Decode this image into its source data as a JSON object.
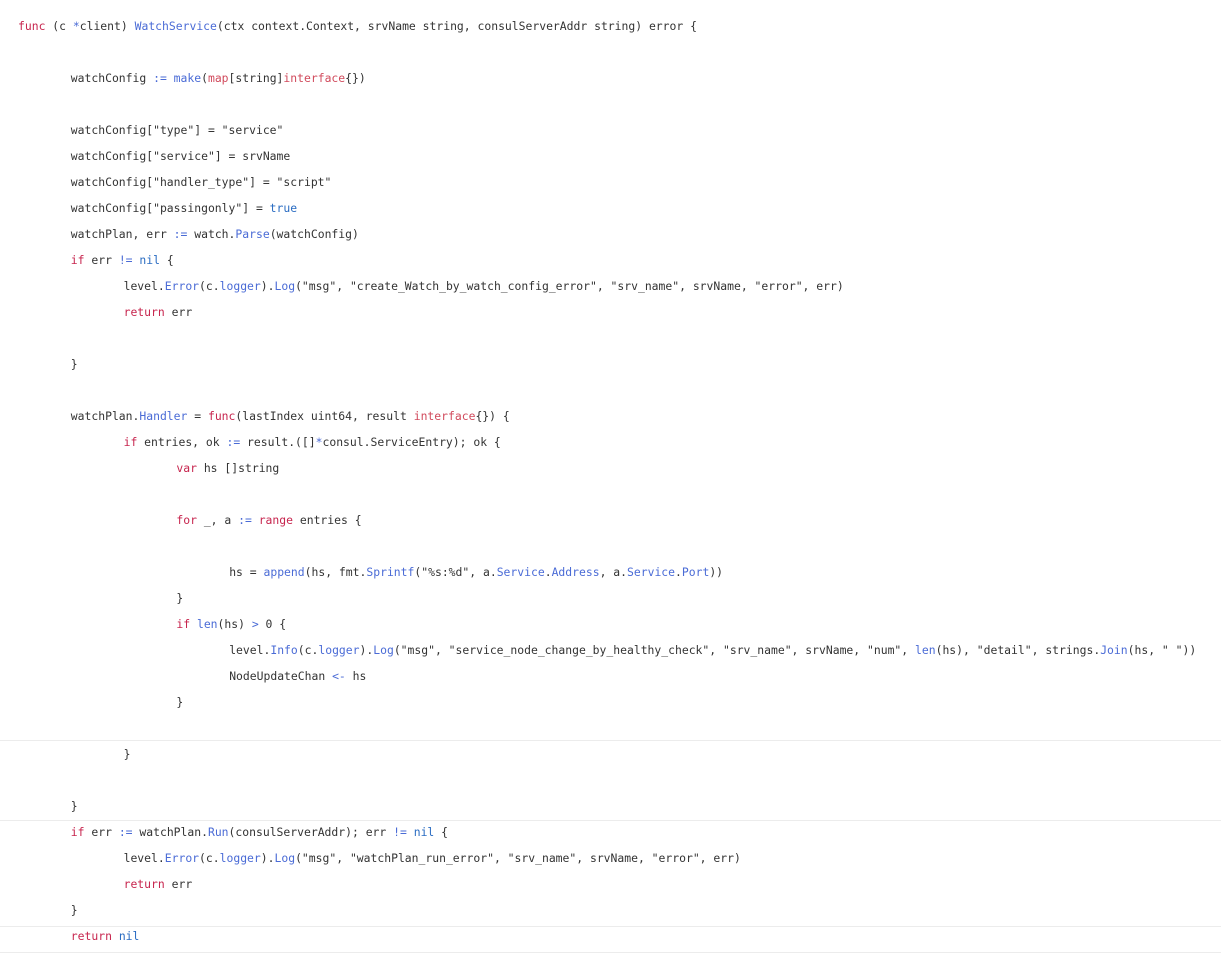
{
  "colors": {
    "background": "#ffffff",
    "plain": "#333333",
    "keyword": "#c7254e",
    "function": "#4a6bd6",
    "type": "#d14a5c",
    "literal": "#2a6cc2"
  },
  "code": {
    "language": "go",
    "lines": [
      {
        "indent": 0,
        "tokens": [
          [
            "k",
            "func"
          ],
          [
            "p",
            " (c "
          ],
          [
            "o",
            "*"
          ],
          [
            "p",
            "client) "
          ],
          [
            "f",
            "WatchService"
          ],
          [
            "p",
            "(ctx context.Context, srvName string, consulServerAddr string) error {"
          ]
        ]
      },
      {
        "indent": 0,
        "tokens": []
      },
      {
        "indent": 1,
        "tokens": [
          [
            "p",
            "watchConfig "
          ],
          [
            "o",
            ":="
          ],
          [
            "p",
            " "
          ],
          [
            "f",
            "make"
          ],
          [
            "p",
            "("
          ],
          [
            "t",
            "map"
          ],
          [
            "p",
            "[string]"
          ],
          [
            "t",
            "interface"
          ],
          [
            "p",
            "{})"
          ]
        ]
      },
      {
        "indent": 0,
        "tokens": []
      },
      {
        "indent": 1,
        "tokens": [
          [
            "p",
            "watchConfig[\"type\"] = \"service\""
          ]
        ]
      },
      {
        "indent": 1,
        "tokens": [
          [
            "p",
            "watchConfig[\"service\"] = srvName"
          ]
        ]
      },
      {
        "indent": 1,
        "tokens": [
          [
            "p",
            "watchConfig[\"handler_type\"] = \"script\""
          ]
        ]
      },
      {
        "indent": 1,
        "tokens": [
          [
            "p",
            "watchConfig[\"passingonly\"] = "
          ],
          [
            "l",
            "true"
          ]
        ]
      },
      {
        "indent": 1,
        "tokens": [
          [
            "p",
            "watchPlan, err "
          ],
          [
            "o",
            ":="
          ],
          [
            "p",
            " watch."
          ],
          [
            "f",
            "Parse"
          ],
          [
            "p",
            "(watchConfig)"
          ]
        ]
      },
      {
        "indent": 1,
        "tokens": [
          [
            "k",
            "if"
          ],
          [
            "p",
            " err "
          ],
          [
            "o",
            "!="
          ],
          [
            "p",
            " "
          ],
          [
            "l",
            "nil"
          ],
          [
            "p",
            " {"
          ]
        ]
      },
      {
        "indent": 2,
        "tokens": [
          [
            "p",
            "level."
          ],
          [
            "f",
            "Error"
          ],
          [
            "p",
            "(c."
          ],
          [
            "f",
            "logger"
          ],
          [
            "p",
            ")."
          ],
          [
            "f",
            "Log"
          ],
          [
            "p",
            "(\"msg\", \"create_Watch_by_watch_config_error\", \"srv_name\", srvName, \"error\", err)"
          ]
        ]
      },
      {
        "indent": 2,
        "tokens": [
          [
            "k",
            "return"
          ],
          [
            "p",
            " err"
          ]
        ]
      },
      {
        "indent": 0,
        "tokens": []
      },
      {
        "indent": 1,
        "tokens": [
          [
            "p",
            "}"
          ]
        ]
      },
      {
        "indent": 0,
        "tokens": []
      },
      {
        "indent": 1,
        "tokens": [
          [
            "p",
            "watchPlan."
          ],
          [
            "f",
            "Handler"
          ],
          [
            "p",
            " = "
          ],
          [
            "k",
            "func"
          ],
          [
            "p",
            "(lastIndex uint64, result "
          ],
          [
            "t",
            "interface"
          ],
          [
            "p",
            "{}) {"
          ]
        ]
      },
      {
        "indent": 2,
        "tokens": [
          [
            "k",
            "if"
          ],
          [
            "p",
            " entries, ok "
          ],
          [
            "o",
            ":="
          ],
          [
            "p",
            " result.([]"
          ],
          [
            "o",
            "*"
          ],
          [
            "p",
            "consul.ServiceEntry); ok {"
          ]
        ]
      },
      {
        "indent": 3,
        "tokens": [
          [
            "k",
            "var"
          ],
          [
            "p",
            " hs []string"
          ]
        ]
      },
      {
        "indent": 0,
        "tokens": []
      },
      {
        "indent": 3,
        "tokens": [
          [
            "k",
            "for"
          ],
          [
            "p",
            " _, a "
          ],
          [
            "o",
            ":="
          ],
          [
            "p",
            " "
          ],
          [
            "k",
            "range"
          ],
          [
            "p",
            " entries {"
          ]
        ]
      },
      {
        "indent": 0,
        "tokens": []
      },
      {
        "indent": 4,
        "tokens": [
          [
            "p",
            "hs = "
          ],
          [
            "f",
            "append"
          ],
          [
            "p",
            "(hs, fmt."
          ],
          [
            "f",
            "Sprintf"
          ],
          [
            "p",
            "(\"%s:%d\", a."
          ],
          [
            "f",
            "Service"
          ],
          [
            "p",
            "."
          ],
          [
            "f",
            "Address"
          ],
          [
            "p",
            ", a."
          ],
          [
            "f",
            "Service"
          ],
          [
            "p",
            "."
          ],
          [
            "f",
            "Port"
          ],
          [
            "p",
            "))"
          ]
        ]
      },
      {
        "indent": 3,
        "tokens": [
          [
            "p",
            "}"
          ]
        ]
      },
      {
        "indent": 3,
        "tokens": [
          [
            "k",
            "if"
          ],
          [
            "p",
            " "
          ],
          [
            "f",
            "len"
          ],
          [
            "p",
            "(hs) "
          ],
          [
            "o",
            ">"
          ],
          [
            "p",
            " 0 {"
          ]
        ]
      },
      {
        "indent": 4,
        "tokens": [
          [
            "p",
            "level."
          ],
          [
            "f",
            "Info"
          ],
          [
            "p",
            "(c."
          ],
          [
            "f",
            "logger"
          ],
          [
            "p",
            ")."
          ],
          [
            "f",
            "Log"
          ],
          [
            "p",
            "(\"msg\", \"service_node_change_by_healthy_check\", \"srv_name\", srvName, \"num\", "
          ],
          [
            "f",
            "len"
          ],
          [
            "p",
            "(hs), \"detail\", strings."
          ],
          [
            "f",
            "Join"
          ],
          [
            "p",
            "(hs, \" \"))"
          ]
        ]
      },
      {
        "indent": 4,
        "tokens": [
          [
            "p",
            "NodeUpdateChan "
          ],
          [
            "o",
            "<-"
          ],
          [
            "p",
            " hs"
          ]
        ]
      },
      {
        "indent": 3,
        "tokens": [
          [
            "p",
            "}"
          ]
        ]
      },
      {
        "indent": 0,
        "tokens": []
      },
      {
        "indent": 2,
        "tokens": [
          [
            "p",
            "}"
          ]
        ]
      },
      {
        "indent": 0,
        "tokens": []
      },
      {
        "indent": 1,
        "tokens": [
          [
            "p",
            "}"
          ]
        ]
      },
      {
        "indent": 1,
        "tokens": [
          [
            "k",
            "if"
          ],
          [
            "p",
            " err "
          ],
          [
            "o",
            ":="
          ],
          [
            "p",
            " watchPlan."
          ],
          [
            "f",
            "Run"
          ],
          [
            "p",
            "(consulServerAddr); err "
          ],
          [
            "o",
            "!="
          ],
          [
            "p",
            " "
          ],
          [
            "l",
            "nil"
          ],
          [
            "p",
            " {"
          ]
        ]
      },
      {
        "indent": 2,
        "tokens": [
          [
            "p",
            "level."
          ],
          [
            "f",
            "Error"
          ],
          [
            "p",
            "(c."
          ],
          [
            "f",
            "logger"
          ],
          [
            "p",
            ")."
          ],
          [
            "f",
            "Log"
          ],
          [
            "p",
            "(\"msg\", \"watchPlan_run_error\", \"srv_name\", srvName, \"error\", err)"
          ]
        ]
      },
      {
        "indent": 2,
        "tokens": [
          [
            "k",
            "return"
          ],
          [
            "p",
            " err"
          ]
        ]
      },
      {
        "indent": 1,
        "tokens": [
          [
            "p",
            "}"
          ]
        ]
      },
      {
        "indent": 1,
        "tokens": [
          [
            "k",
            "return"
          ],
          [
            "p",
            " "
          ],
          [
            "l",
            "nil"
          ]
        ]
      }
    ]
  }
}
